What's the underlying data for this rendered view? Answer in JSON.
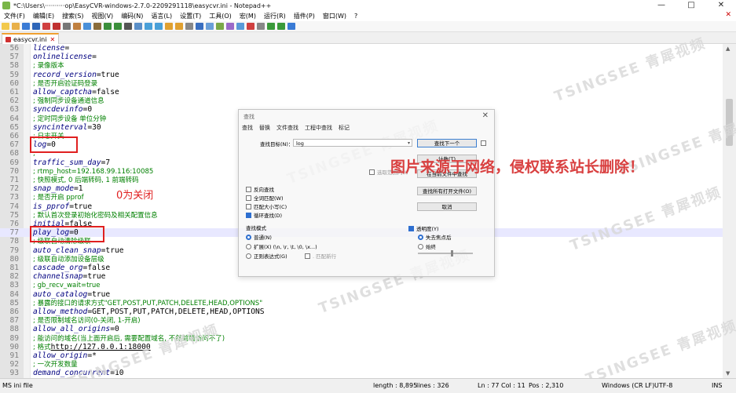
{
  "window": {
    "title": "*C:\\Users\\··········op\\EasyCVR-windows-2.7.0-2209291118\\easycvr.ini - Notepad++",
    "controls": {
      "minimize": "—",
      "maximize": "□",
      "close": "✕"
    }
  },
  "menu": [
    "文件(F)",
    "编辑(E)",
    "搜索(S)",
    "视图(V)",
    "编码(N)",
    "语言(L)",
    "设置(T)",
    "工具(O)",
    "宏(M)",
    "运行(R)",
    "插件(P)",
    "窗口(W)",
    "?"
  ],
  "menu_close": "✕",
  "tab": {
    "label": "easycvr.ini",
    "close": "✕"
  },
  "lines": [
    {
      "n": "56",
      "parts": [
        {
          "t": "k",
          "s": "license"
        },
        {
          "t": "eq",
          "s": "="
        }
      ]
    },
    {
      "n": "57",
      "parts": [
        {
          "t": "k",
          "s": "onlinelicense"
        },
        {
          "t": "eq",
          "s": "="
        }
      ]
    },
    {
      "n": "58",
      "parts": [
        {
          "t": "c",
          "s": "; 录像版本"
        }
      ]
    },
    {
      "n": "59",
      "parts": [
        {
          "t": "k",
          "s": "record_version"
        },
        {
          "t": "eq",
          "s": "="
        },
        {
          "t": "v",
          "s": "true"
        }
      ]
    },
    {
      "n": "60",
      "parts": [
        {
          "t": "c",
          "s": "; 是否开启验证码登录"
        }
      ]
    },
    {
      "n": "61",
      "parts": [
        {
          "t": "k",
          "s": "allow_captcha"
        },
        {
          "t": "eq",
          "s": "="
        },
        {
          "t": "v",
          "s": "false"
        }
      ]
    },
    {
      "n": "62",
      "parts": [
        {
          "t": "c",
          "s": "; 强制同步设备通道信息"
        }
      ]
    },
    {
      "n": "63",
      "parts": [
        {
          "t": "k",
          "s": "syncdevinfo"
        },
        {
          "t": "eq",
          "s": "="
        },
        {
          "t": "v",
          "s": "0"
        }
      ]
    },
    {
      "n": "64",
      "parts": [
        {
          "t": "c",
          "s": "; 定时同步设备 单位分钟"
        }
      ]
    },
    {
      "n": "65",
      "parts": [
        {
          "t": "k",
          "s": "syncinterval"
        },
        {
          "t": "eq",
          "s": "="
        },
        {
          "t": "v",
          "s": "30"
        }
      ]
    },
    {
      "n": "66",
      "parts": [
        {
          "t": "c",
          "s": "; 日志开关"
        }
      ]
    },
    {
      "n": "67",
      "parts": [
        {
          "t": "k",
          "s": "log"
        },
        {
          "t": "eq",
          "s": "="
        },
        {
          "t": "v",
          "s": "0"
        }
      ]
    },
    {
      "n": "68",
      "parts": [
        {
          "t": "c",
          "s": ";"
        }
      ]
    },
    {
      "n": "69",
      "parts": [
        {
          "t": "k",
          "s": "traffic_sum_day"
        },
        {
          "t": "eq",
          "s": "="
        },
        {
          "t": "v",
          "s": "7"
        }
      ]
    },
    {
      "n": "70",
      "parts": [
        {
          "t": "c",
          "s": "; rtmp_host=192.168.99.116:10085"
        }
      ]
    },
    {
      "n": "71",
      "parts": [
        {
          "t": "c",
          "s": "; 快照模式, 0 后端转码, 1 前端转码"
        }
      ]
    },
    {
      "n": "72",
      "parts": [
        {
          "t": "k",
          "s": "snap_mode"
        },
        {
          "t": "eq",
          "s": "="
        },
        {
          "t": "v",
          "s": "1"
        }
      ]
    },
    {
      "n": "73",
      "parts": [
        {
          "t": "c",
          "s": "; 是否开启 pprof"
        }
      ]
    },
    {
      "n": "74",
      "parts": [
        {
          "t": "k",
          "s": "is_pprof"
        },
        {
          "t": "eq",
          "s": "="
        },
        {
          "t": "v",
          "s": "true"
        }
      ]
    },
    {
      "n": "75",
      "parts": [
        {
          "t": "c",
          "s": "; 默认首次登录初始化密码及相关配置信息"
        }
      ]
    },
    {
      "n": "76",
      "parts": [
        {
          "t": "k",
          "s": "initial"
        },
        {
          "t": "eq",
          "s": "="
        },
        {
          "t": "v",
          "s": "false"
        }
      ]
    },
    {
      "n": "77",
      "parts": [
        {
          "t": "k",
          "s": "play_log"
        },
        {
          "t": "eq",
          "s": "="
        },
        {
          "t": "v",
          "s": "0"
        }
      ]
    },
    {
      "n": "78",
      "parts": [
        {
          "t": "c",
          "s": "; 级联自动清除级联"
        }
      ]
    },
    {
      "n": "79",
      "parts": [
        {
          "t": "k",
          "s": "auto_clean_snap"
        },
        {
          "t": "eq",
          "s": "="
        },
        {
          "t": "v",
          "s": "true"
        }
      ]
    },
    {
      "n": "80",
      "parts": [
        {
          "t": "c",
          "s": "; 级联自动添加设备层级"
        }
      ]
    },
    {
      "n": "81",
      "parts": [
        {
          "t": "k",
          "s": "cascade_org"
        },
        {
          "t": "eq",
          "s": "="
        },
        {
          "t": "v",
          "s": "false"
        }
      ]
    },
    {
      "n": "82",
      "parts": [
        {
          "t": "k",
          "s": "channelsnap"
        },
        {
          "t": "eq",
          "s": "="
        },
        {
          "t": "v",
          "s": "true"
        }
      ]
    },
    {
      "n": "83",
      "parts": [
        {
          "t": "c",
          "s": "; gb_recv_wait=true"
        }
      ]
    },
    {
      "n": "84",
      "parts": [
        {
          "t": "k",
          "s": "auto_catalog"
        },
        {
          "t": "eq",
          "s": "="
        },
        {
          "t": "v",
          "s": "true"
        }
      ]
    },
    {
      "n": "85",
      "parts": [
        {
          "t": "c",
          "s": "; 暴露的接口的请求方式\"GET,POST,PUT,PATCH,DELETE,HEAD,OPTIONS\""
        }
      ]
    },
    {
      "n": "86",
      "parts": [
        {
          "t": "k",
          "s": "allow_method"
        },
        {
          "t": "eq",
          "s": "="
        },
        {
          "t": "v",
          "s": "GET,POST,PUT,PATCH,DELETE,HEAD,OPTIONS"
        }
      ]
    },
    {
      "n": "87",
      "parts": [
        {
          "t": "c",
          "s": "; 是否限制域名访问(0-关闭, 1-开启)"
        }
      ]
    },
    {
      "n": "88",
      "parts": [
        {
          "t": "k",
          "s": "allow_all_origins"
        },
        {
          "t": "eq",
          "s": "="
        },
        {
          "t": "v",
          "s": "0"
        }
      ]
    },
    {
      "n": "89",
      "parts": [
        {
          "t": "c",
          "s": "; 能访问的域名(当上面开启后, 需要配置域名, 不然前端访问不了)"
        }
      ]
    },
    {
      "n": "90",
      "parts": [
        {
          "t": "c",
          "s": "; 格式"
        },
        {
          "t": "u",
          "s": "http://127.0.0.1:18000"
        }
      ]
    },
    {
      "n": "91",
      "parts": [
        {
          "t": "k",
          "s": "allow_origin"
        },
        {
          "t": "eq",
          "s": "="
        },
        {
          "t": "v",
          "s": "*"
        }
      ]
    },
    {
      "n": "92",
      "parts": [
        {
          "t": "c",
          "s": "; 一次开发数量"
        }
      ]
    },
    {
      "n": "93",
      "parts": [
        {
          "t": "k",
          "s": "demand_concurrent"
        },
        {
          "t": "eq",
          "s": "="
        },
        {
          "t": "v",
          "s": "10"
        }
      ]
    }
  ],
  "annotation": "0为关闭",
  "disclaimer": "图片来源于网络，侵权联系站长删除！",
  "watermark": "TSINGSEE 青犀视频",
  "find_dialog": {
    "title": "查找",
    "close": "✕",
    "tabs": [
      "查找",
      "替换",
      "文件查找",
      "工程中查找",
      "标记"
    ],
    "find_label": "查找目标(N)：",
    "find_value": "log",
    "dropdown": "▾",
    "buttons": {
      "find_next": "查找下一个",
      "count": "计数(T)",
      "find_in_current": "在当前文件中查找",
      "find_in_all_open": "查找所有打开文件(O)",
      "cancel": "取消"
    },
    "in_selection": "选取范围内(I)",
    "options": [
      {
        "label": "反向查找",
        "checked": false
      },
      {
        "label": "全词匹配(W)",
        "checked": false
      },
      {
        "label": "匹配大小写(C)",
        "checked": false
      },
      {
        "label": "循环查找(D)",
        "checked": true
      }
    ],
    "search_mode_label": "查找模式",
    "search_modes": [
      {
        "label": "普通(N)",
        "checked": true
      },
      {
        "label": "扩展(X) (\\n, \\r, \\t, \\0, \\x...)",
        "checked": false
      },
      {
        "label": "正则表达式(G)",
        "checked": false
      }
    ],
    "matches_newline": ". 匹配新行",
    "transparency_label": "透明度(Y)",
    "transparency_checked": true,
    "transparency_modes": [
      {
        "label": "失去焦点后",
        "checked": true
      },
      {
        "label": "始终",
        "checked": false
      }
    ],
    "transparency_level": 0.6
  },
  "status": {
    "filetype": "MS ini file",
    "length": "length : 8,895",
    "lines": "lines : 326",
    "ln": "Ln : 77",
    "col": "Col : 11",
    "pos": "Pos : 2,310",
    "eol": "Windows (CR LF)",
    "encoding": "UTF-8",
    "mode": "INS"
  }
}
